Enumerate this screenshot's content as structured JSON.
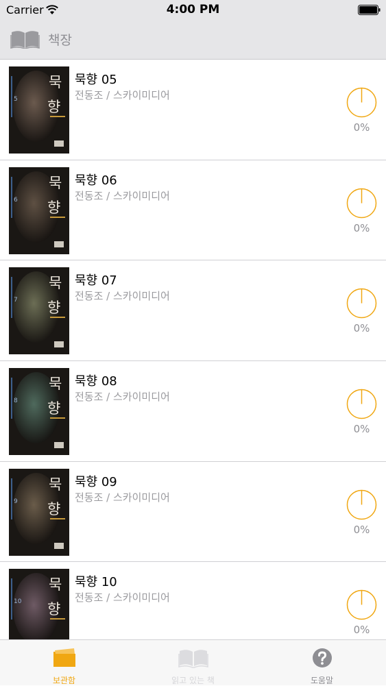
{
  "status_bar": {
    "carrier": "Carrier",
    "time": "4:00 PM",
    "icons": [
      "wifi-icon",
      "battery-icon"
    ]
  },
  "navbar": {
    "title": "책장",
    "icon": "open-book-icon"
  },
  "books": [
    {
      "title": "묵향 05",
      "author": "전동조 / 스카이미디어",
      "progress": "0%",
      "progress_value": 0,
      "cover_volume": "5",
      "cover_tint": "#6b5a4e"
    },
    {
      "title": "묵향 06",
      "author": "전동조 / 스카이미디어",
      "progress": "0%",
      "progress_value": 0,
      "cover_volume": "6",
      "cover_tint": "#5e5043"
    },
    {
      "title": "묵향 07",
      "author": "전동조 / 스카이미디어",
      "progress": "0%",
      "progress_value": 0,
      "cover_volume": "7",
      "cover_tint": "#6c6e55"
    },
    {
      "title": "묵향 08",
      "author": "전동조 / 스카이미디어",
      "progress": "0%",
      "progress_value": 0,
      "cover_volume": "8",
      "cover_tint": "#4f6a5d"
    },
    {
      "title": "묵향 09",
      "author": "전동조 / 스카이미디어",
      "progress": "0%",
      "progress_value": 0,
      "cover_volume": "9",
      "cover_tint": "#6a5c4a"
    },
    {
      "title": "묵향 10",
      "author": "전동조 / 스카이미디어",
      "progress": "0%",
      "progress_value": 0,
      "cover_volume": "10",
      "cover_tint": "#6e5a64"
    }
  ],
  "cover_text": {
    "title_top": "묵",
    "title_bottom": "향"
  },
  "tabbar": {
    "tabs": [
      {
        "label": "보관함",
        "icon": "folder-icon",
        "state": "active"
      },
      {
        "label": "읽고 있는 책",
        "icon": "open-book-icon",
        "state": "disabled"
      },
      {
        "label": "도움말",
        "icon": "help-icon",
        "state": "normal"
      }
    ]
  },
  "colors": {
    "accent": "#f0a712",
    "bar_background": "#e6e6e8",
    "secondary_text": "#9a9a9e"
  }
}
